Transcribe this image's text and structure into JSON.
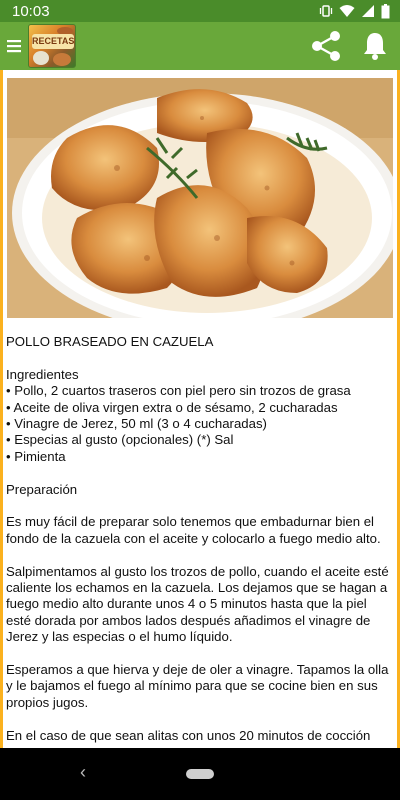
{
  "status_bar": {
    "time": "10:03",
    "icons": [
      "vibrate-icon",
      "wifi-icon",
      "signal-icon",
      "battery-icon"
    ]
  },
  "app_bar": {
    "logo_text": "RECETAS",
    "icons": [
      "menu-icon",
      "share-icon",
      "bell-icon"
    ]
  },
  "colors": {
    "status_bar": "#4a8c2a",
    "app_bar": "#69a83a",
    "frame": "#fbb11e"
  },
  "article": {
    "title": "POLLO BRASEADO EN CAZUELA",
    "ingredients_heading": "Ingredientes",
    "ingredients": [
      "• Pollo, 2 cuartos traseros con piel pero sin trozos de grasa",
      "• Aceite de oliva virgen extra o de sésamo, 2 cucharadas",
      "• Vinagre de Jerez, 50 ml (3 o 4 cucharadas)",
      "• Especias al gusto (opcionales) (*) Sal",
      "• Pimienta"
    ],
    "preparation_heading": "Preparación",
    "paragraphs": [
      "Es muy fácil de preparar solo tenemos que embadurnar bien el fondo de la cazuela con el aceite y colocarlo a fuego medio alto.",
      "Salpimentamos al gusto los trozos de pollo, cuando el aceite esté caliente los echamos en la cazuela. Los dejamos que se hagan a fuego medio alto durante unos 4 o 5 minutos hasta que la piel esté dorada por ambos lados después añadimos el vinagre de Jerez y las especias o el humo líquido.",
      "Esperamos a que hierva y deje de oler a vinagre. Tapamos la olla y le bajamos el fuego al mínimo para que se cocine bien en sus propios jugos.",
      "En el caso de que sean alitas con unos 20 minutos de cocción"
    ]
  },
  "nav_bar": {
    "back_glyph": "‹"
  }
}
